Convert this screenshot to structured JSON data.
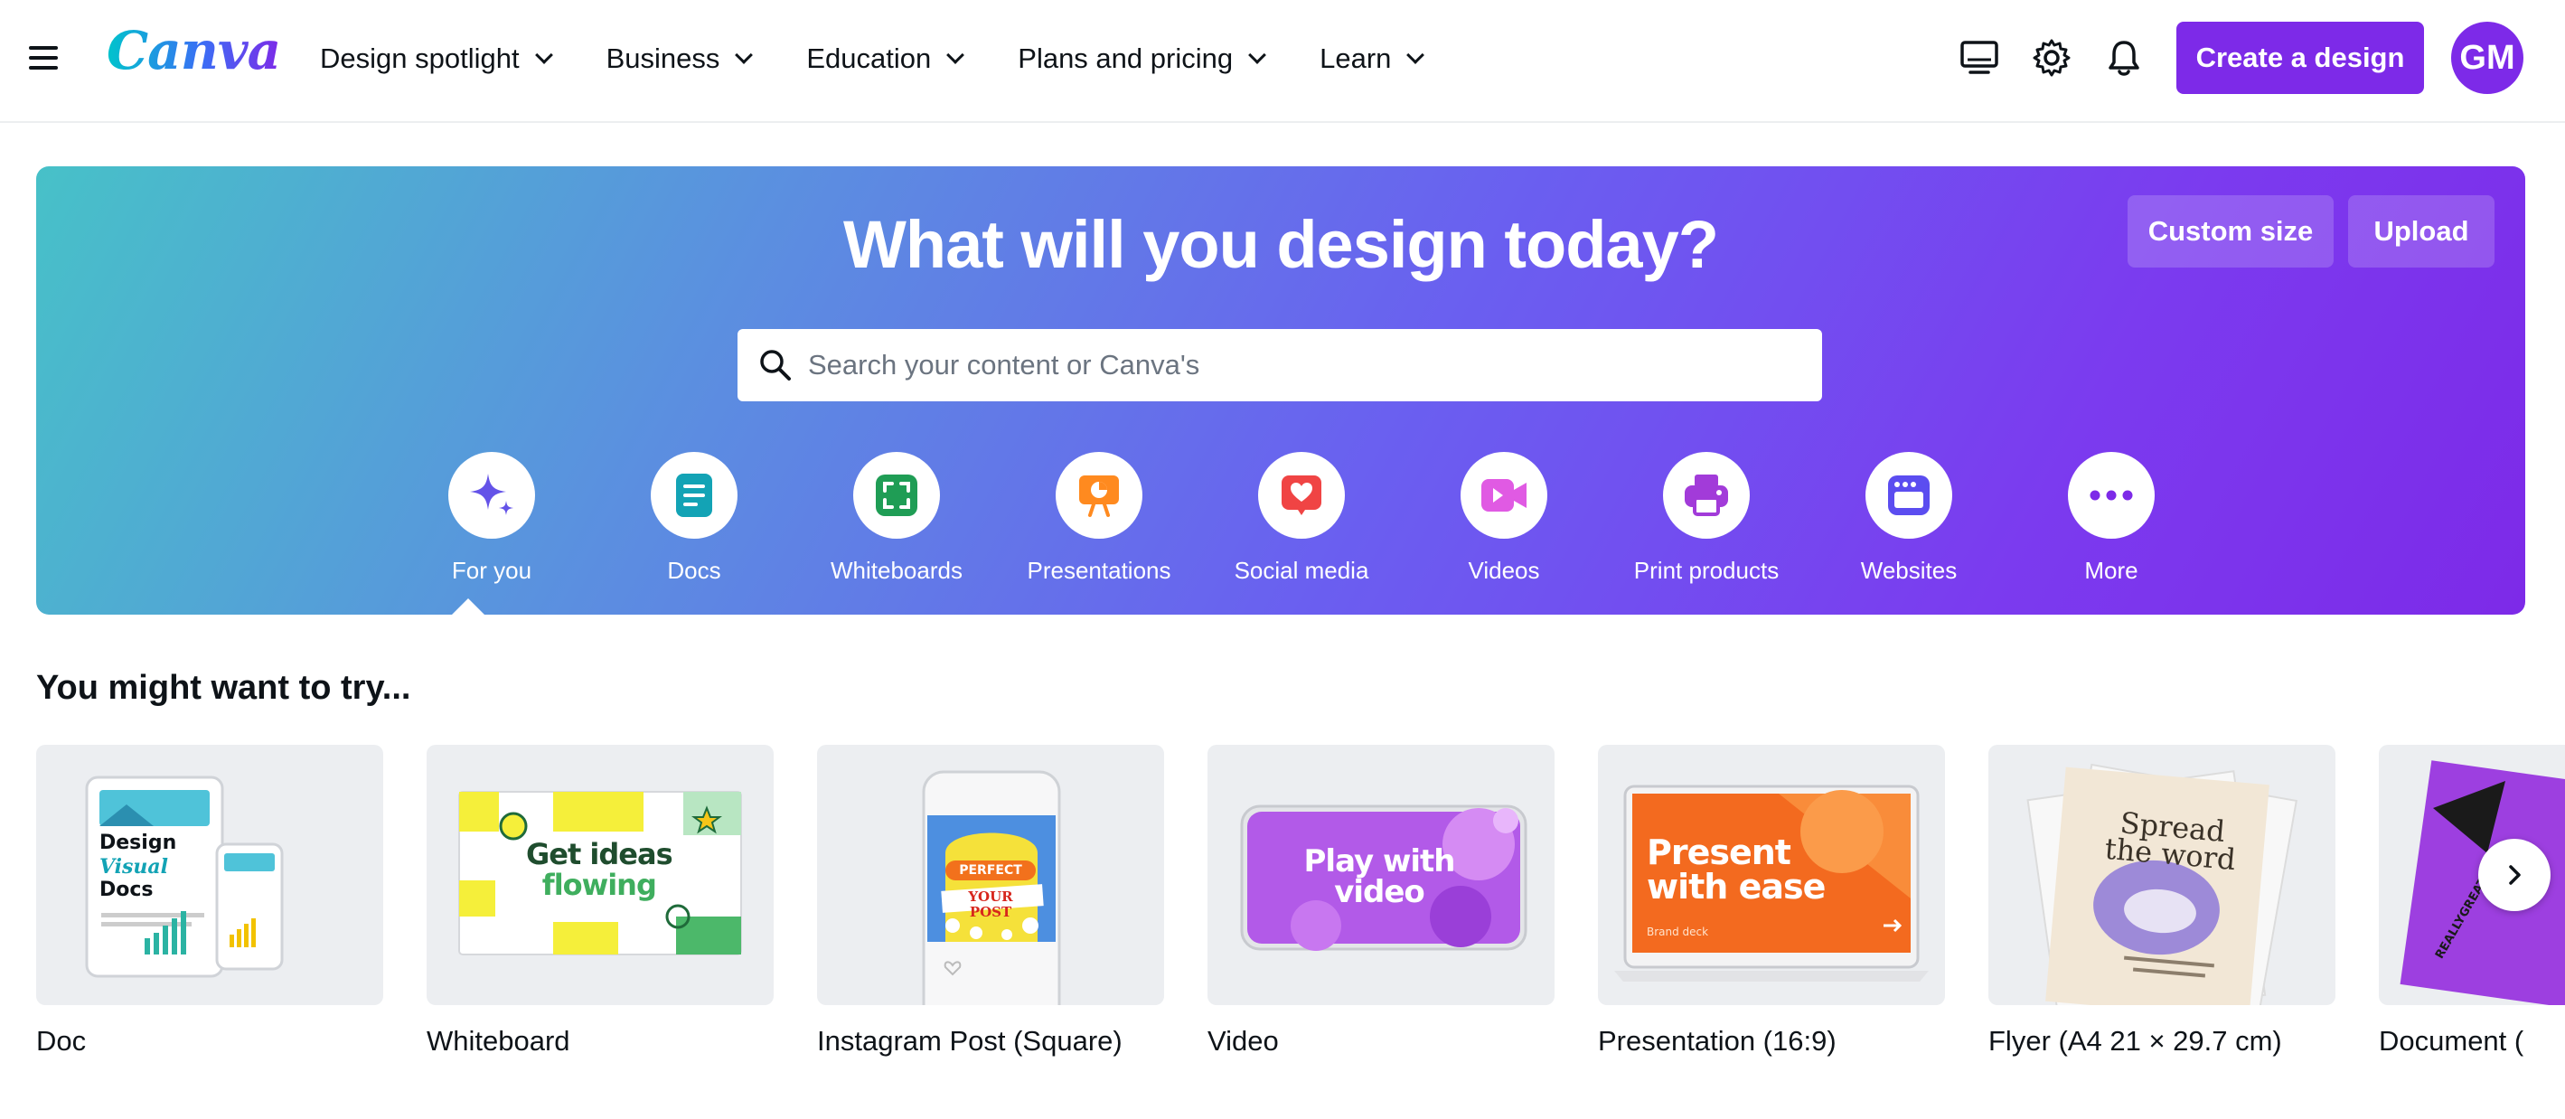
{
  "nav": {
    "logo": "Canva",
    "menu": [
      {
        "label": "Design spotlight"
      },
      {
        "label": "Business"
      },
      {
        "label": "Education"
      },
      {
        "label": "Plans and pricing"
      },
      {
        "label": "Learn"
      }
    ],
    "create_label": "Create a design",
    "avatar_initials": "GM",
    "accent": "#7d2ae8"
  },
  "hero": {
    "title": "What will you design today?",
    "custom_size_label": "Custom size",
    "upload_label": "Upload",
    "search_placeholder": "Search your content or Canva's",
    "categories": [
      {
        "label": "For you",
        "icon": "sparkle-icon",
        "color": "#6453e8"
      },
      {
        "label": "Docs",
        "icon": "doc-icon",
        "color": "#13a3b5"
      },
      {
        "label": "Whiteboards",
        "icon": "whiteboard-icon",
        "color": "#1f9d55"
      },
      {
        "label": "Presentations",
        "icon": "presentation-icon",
        "color": "#ff8a1f"
      },
      {
        "label": "Social media",
        "icon": "heart-icon",
        "color": "#f04444"
      },
      {
        "label": "Videos",
        "icon": "video-icon",
        "color": "#e05ae3"
      },
      {
        "label": "Print products",
        "icon": "printer-icon",
        "color": "#a23bd9"
      },
      {
        "label": "Websites",
        "icon": "website-icon",
        "color": "#5b4df0"
      },
      {
        "label": "More",
        "icon": "more-icon",
        "color": "#7d2ae8"
      }
    ],
    "selected_category": "For you"
  },
  "suggestions": {
    "title": "You might want to try...",
    "items": [
      {
        "label": "Doc",
        "thumb_lines": [
          "Design",
          "Visual",
          "Docs"
        ]
      },
      {
        "label": "Whiteboard",
        "thumb_lines": [
          "Get ideas",
          "flowing"
        ]
      },
      {
        "label": "Instagram Post (Square)",
        "thumb_lines": [
          "PERFECT",
          "YOUR POST"
        ]
      },
      {
        "label": "Video",
        "thumb_lines": [
          "Play with",
          "video"
        ]
      },
      {
        "label": "Presentation (16:9)",
        "thumb_lines": [
          "Present",
          "with ease",
          "Brand deck"
        ]
      },
      {
        "label": "Flyer (A4 21 × 29.7 cm)",
        "thumb_lines": [
          "Spread",
          "the word"
        ]
      },
      {
        "label": "Document (",
        "thumb_lines": [
          "REALLYGREAT"
        ]
      }
    ]
  }
}
